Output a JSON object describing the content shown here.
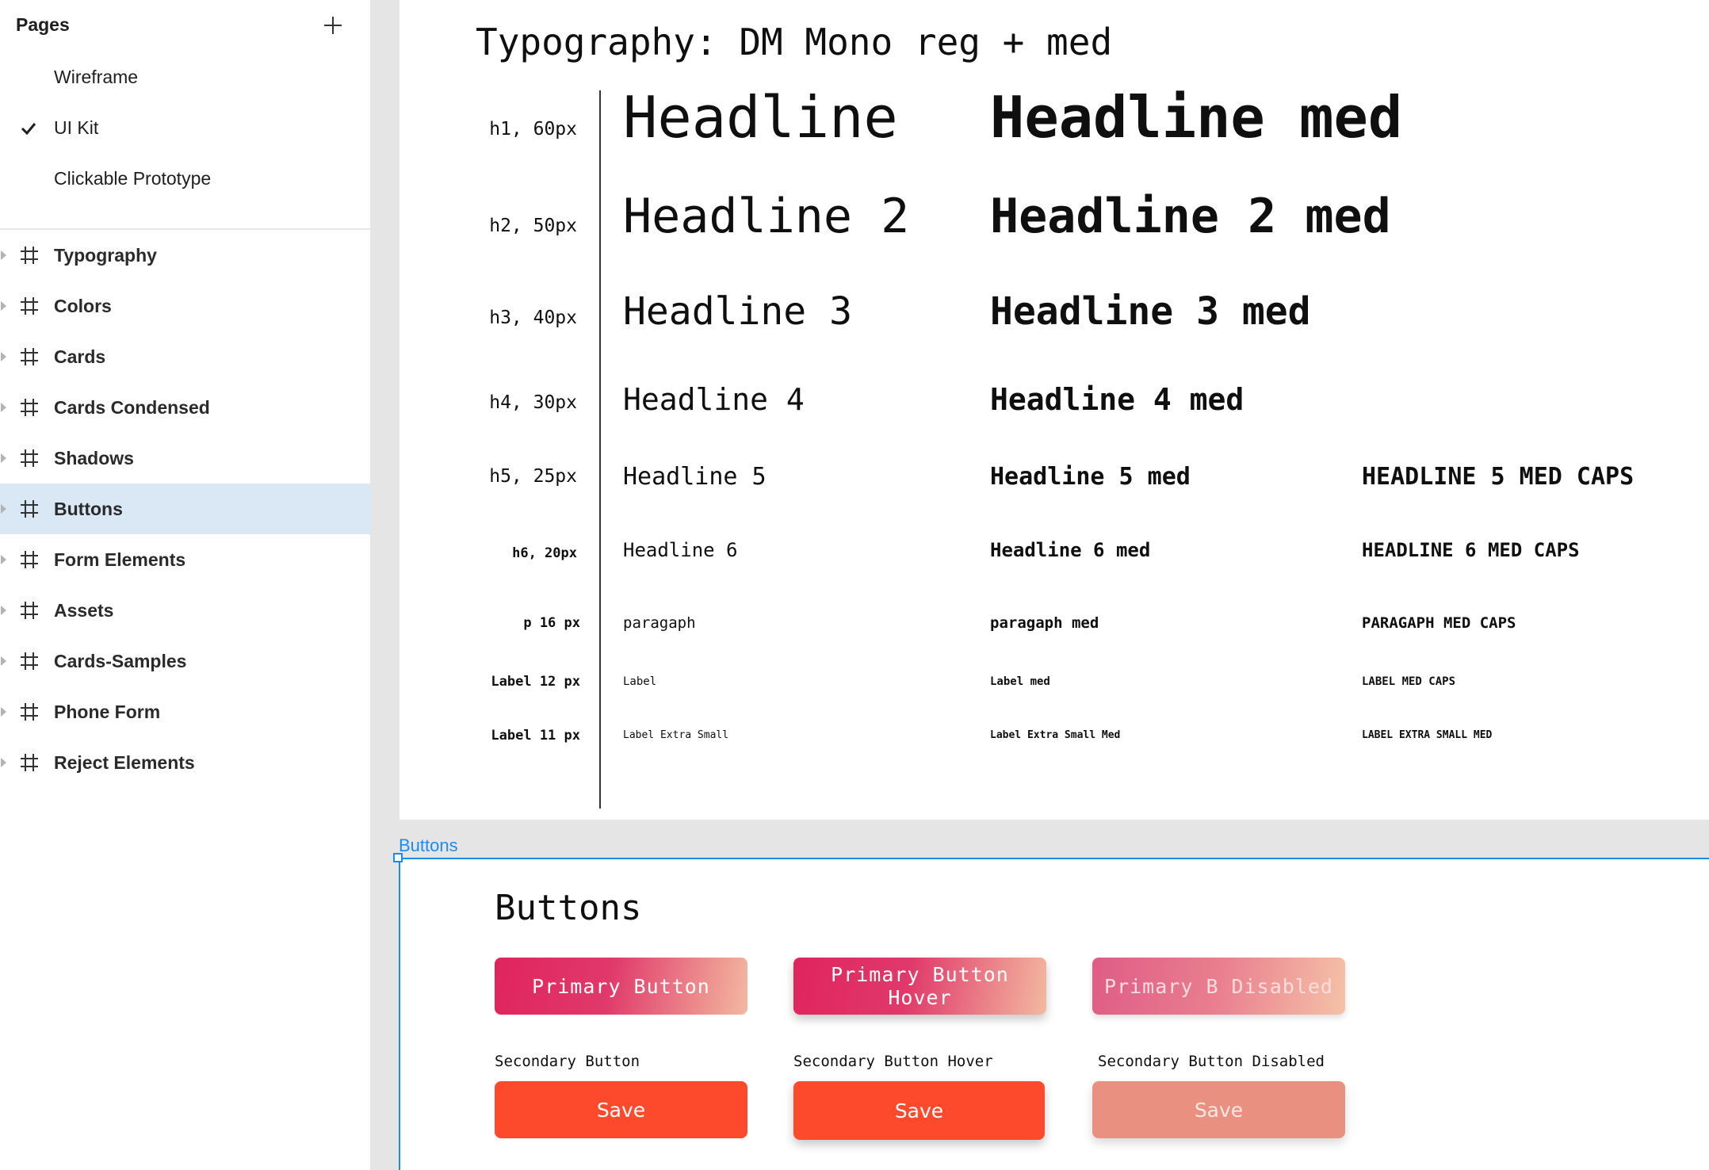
{
  "sidebar": {
    "pages_title": "Pages",
    "pages": [
      {
        "label": "Wireframe",
        "checked": false
      },
      {
        "label": "UI Kit",
        "checked": true
      },
      {
        "label": "Clickable Prototype",
        "checked": false
      }
    ],
    "layers": [
      {
        "label": "Typography",
        "selected": false
      },
      {
        "label": "Colors",
        "selected": false
      },
      {
        "label": "Cards",
        "selected": false
      },
      {
        "label": "Cards Condensed",
        "selected": false
      },
      {
        "label": "Shadows",
        "selected": false
      },
      {
        "label": "Buttons",
        "selected": true
      },
      {
        "label": "Form Elements",
        "selected": false
      },
      {
        "label": "Assets",
        "selected": false
      },
      {
        "label": "Cards-Samples",
        "selected": false
      },
      {
        "label": "Phone Form",
        "selected": false
      },
      {
        "label": "Reject Elements",
        "selected": false
      }
    ],
    "icons": {
      "add": "plus-icon",
      "check": "check-icon",
      "frame": "hash-frame-icon",
      "caret": "caret-right-icon"
    }
  },
  "typography": {
    "title": "Typography: DM Mono reg + med",
    "rows": [
      {
        "label": "h1, 60px",
        "reg": "Headline",
        "med": "Headline med",
        "caps": ""
      },
      {
        "label": "h2, 50px",
        "reg": "Headline 2",
        "med": "Headline 2 med",
        "caps": ""
      },
      {
        "label": "h3, 40px",
        "reg": "Headline 3",
        "med": "Headline 3 med",
        "caps": ""
      },
      {
        "label": "h4, 30px",
        "reg": "Headline 4",
        "med": "Headline 4 med",
        "caps": ""
      },
      {
        "label": "h5, 25px",
        "reg": "Headline 5",
        "med": "Headline 5 med",
        "caps": "HEADLINE 5 MED CAPS"
      },
      {
        "label": "h6, 20px",
        "reg": "Headline 6",
        "med": "Headline 6 med",
        "caps": "HEADLINE 6 MED CAPS"
      },
      {
        "label": "p 16 px",
        "reg": "paragaph",
        "med": "paragaph med",
        "caps": "PARAGAPH MED CAPS"
      },
      {
        "label": "Label 12 px",
        "reg": "Label",
        "med": "Label med",
        "caps": "LABEL MED CAPS"
      },
      {
        "label": "Label 11 px",
        "reg": "Label Extra Small",
        "med": "Label Extra Small Med",
        "caps": "LABEL EXTRA SMALL MED"
      }
    ]
  },
  "buttons_frame": {
    "frame_label": "Buttons",
    "title": "Buttons",
    "primary": [
      "Primary Button",
      "Primary Button Hover",
      "Primary B Disabled"
    ],
    "secondary_captions": [
      "Secondary Button",
      "Secondary Button Hover",
      "Secondary Button Disabled"
    ],
    "secondary_label": "Save"
  },
  "colors": {
    "accent_selection": "#1a8cf0",
    "selected_layer_bg": "#dae8f5",
    "primary_gradient_start": "#e0245e",
    "primary_gradient_end": "#f3b9a0",
    "secondary": "#fe4a2c",
    "secondary_disabled": "#ea9080"
  }
}
